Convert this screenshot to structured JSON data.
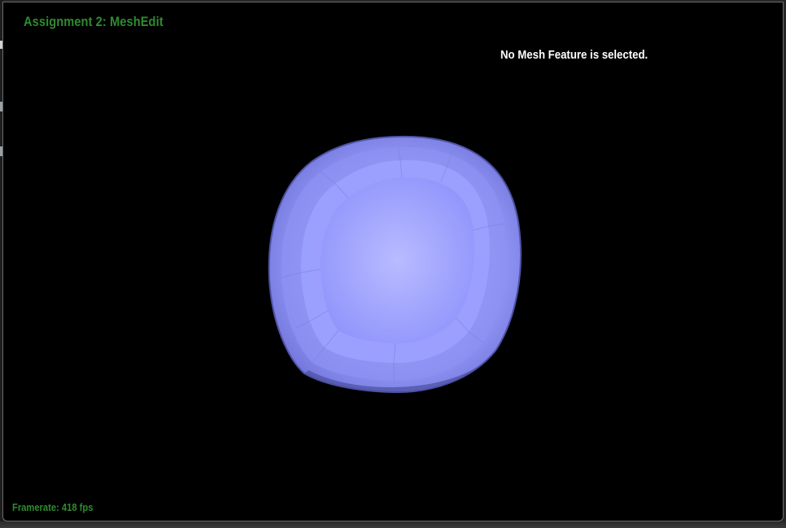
{
  "app": {
    "title": "Assignment 2: MeshEdit"
  },
  "overlay": {
    "selection_status": "No Mesh Feature is selected.",
    "framerate": "Framerate: 418 fps"
  },
  "scene": {
    "object": "smooth-subdivided-mesh",
    "background_color": "#000000",
    "mesh_color": "#8f94ff"
  },
  "colors": {
    "label_green": "#2e8b2e",
    "status_white": "#ffffff"
  }
}
